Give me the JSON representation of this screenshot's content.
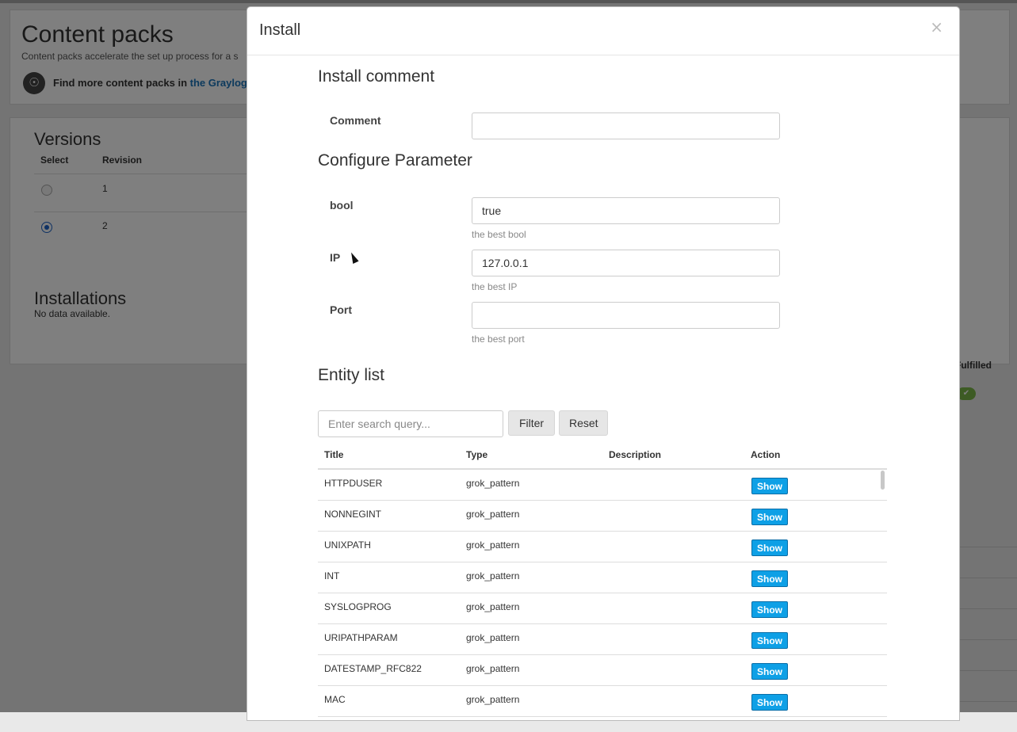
{
  "background": {
    "title": "Content packs",
    "description": "Content packs accelerate the set up process for a s",
    "tip_text": "Find more content packs in ",
    "tip_link": "the Graylog M",
    "versions": {
      "title": "Versions",
      "col_select": "Select",
      "col_revision": "Revision",
      "rows": [
        {
          "revision": "1",
          "selected": false
        },
        {
          "revision": "2",
          "selected": true
        }
      ]
    },
    "installations": {
      "title": "Installations",
      "empty": "No data available."
    },
    "right_header": "Fulfilled",
    "right_check": "✔"
  },
  "modal": {
    "title": "Install",
    "close": "×",
    "install_comment_title": "Install comment",
    "comment_label": "Comment",
    "comment_value": "",
    "configure_title": "Configure Parameter",
    "params": [
      {
        "label": "bool",
        "value": "true",
        "help": "the best bool"
      },
      {
        "label": "IP",
        "value": "127.0.0.1",
        "help": "the best IP"
      },
      {
        "label": "Port",
        "value": "",
        "help": "the best port"
      }
    ],
    "entity_title": "Entity list",
    "search_placeholder": "Enter search query...",
    "filter_label": "Filter",
    "reset_label": "Reset",
    "columns": {
      "title": "Title",
      "type": "Type",
      "description": "Description",
      "action": "Action"
    },
    "show_label": "Show",
    "entities": [
      {
        "title": "HTTPDUSER",
        "type": "grok_pattern"
      },
      {
        "title": "NONNEGINT",
        "type": "grok_pattern"
      },
      {
        "title": "UNIXPATH",
        "type": "grok_pattern"
      },
      {
        "title": "INT",
        "type": "grok_pattern"
      },
      {
        "title": "SYSLOGPROG",
        "type": "grok_pattern"
      },
      {
        "title": "URIPATHPARAM",
        "type": "grok_pattern"
      },
      {
        "title": "DATESTAMP_RFC822",
        "type": "grok_pattern"
      },
      {
        "title": "MAC",
        "type": "grok_pattern"
      }
    ]
  },
  "colors": {
    "show_button": "#0ea0e6",
    "link": "#1a74bb",
    "fulfilled_check": "#7ab648"
  }
}
